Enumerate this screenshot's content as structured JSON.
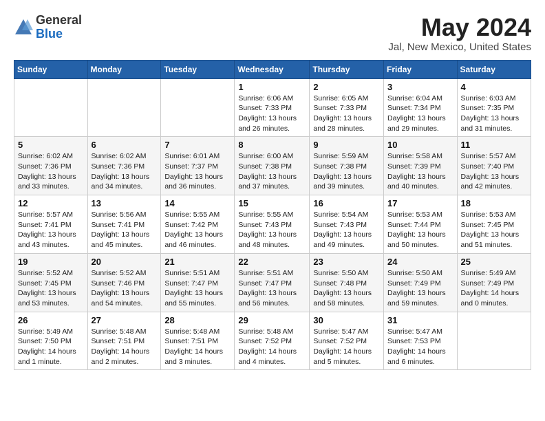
{
  "header": {
    "logo_general": "General",
    "logo_blue": "Blue",
    "title": "May 2024",
    "location": "Jal, New Mexico, United States"
  },
  "weekdays": [
    "Sunday",
    "Monday",
    "Tuesday",
    "Wednesday",
    "Thursday",
    "Friday",
    "Saturday"
  ],
  "weeks": [
    [
      {
        "day": "",
        "info": ""
      },
      {
        "day": "",
        "info": ""
      },
      {
        "day": "",
        "info": ""
      },
      {
        "day": "1",
        "info": "Sunrise: 6:06 AM\nSunset: 7:33 PM\nDaylight: 13 hours\nand 26 minutes."
      },
      {
        "day": "2",
        "info": "Sunrise: 6:05 AM\nSunset: 7:33 PM\nDaylight: 13 hours\nand 28 minutes."
      },
      {
        "day": "3",
        "info": "Sunrise: 6:04 AM\nSunset: 7:34 PM\nDaylight: 13 hours\nand 29 minutes."
      },
      {
        "day": "4",
        "info": "Sunrise: 6:03 AM\nSunset: 7:35 PM\nDaylight: 13 hours\nand 31 minutes."
      }
    ],
    [
      {
        "day": "5",
        "info": "Sunrise: 6:02 AM\nSunset: 7:36 PM\nDaylight: 13 hours\nand 33 minutes."
      },
      {
        "day": "6",
        "info": "Sunrise: 6:02 AM\nSunset: 7:36 PM\nDaylight: 13 hours\nand 34 minutes."
      },
      {
        "day": "7",
        "info": "Sunrise: 6:01 AM\nSunset: 7:37 PM\nDaylight: 13 hours\nand 36 minutes."
      },
      {
        "day": "8",
        "info": "Sunrise: 6:00 AM\nSunset: 7:38 PM\nDaylight: 13 hours\nand 37 minutes."
      },
      {
        "day": "9",
        "info": "Sunrise: 5:59 AM\nSunset: 7:38 PM\nDaylight: 13 hours\nand 39 minutes."
      },
      {
        "day": "10",
        "info": "Sunrise: 5:58 AM\nSunset: 7:39 PM\nDaylight: 13 hours\nand 40 minutes."
      },
      {
        "day": "11",
        "info": "Sunrise: 5:57 AM\nSunset: 7:40 PM\nDaylight: 13 hours\nand 42 minutes."
      }
    ],
    [
      {
        "day": "12",
        "info": "Sunrise: 5:57 AM\nSunset: 7:41 PM\nDaylight: 13 hours\nand 43 minutes."
      },
      {
        "day": "13",
        "info": "Sunrise: 5:56 AM\nSunset: 7:41 PM\nDaylight: 13 hours\nand 45 minutes."
      },
      {
        "day": "14",
        "info": "Sunrise: 5:55 AM\nSunset: 7:42 PM\nDaylight: 13 hours\nand 46 minutes."
      },
      {
        "day": "15",
        "info": "Sunrise: 5:55 AM\nSunset: 7:43 PM\nDaylight: 13 hours\nand 48 minutes."
      },
      {
        "day": "16",
        "info": "Sunrise: 5:54 AM\nSunset: 7:43 PM\nDaylight: 13 hours\nand 49 minutes."
      },
      {
        "day": "17",
        "info": "Sunrise: 5:53 AM\nSunset: 7:44 PM\nDaylight: 13 hours\nand 50 minutes."
      },
      {
        "day": "18",
        "info": "Sunrise: 5:53 AM\nSunset: 7:45 PM\nDaylight: 13 hours\nand 51 minutes."
      }
    ],
    [
      {
        "day": "19",
        "info": "Sunrise: 5:52 AM\nSunset: 7:45 PM\nDaylight: 13 hours\nand 53 minutes."
      },
      {
        "day": "20",
        "info": "Sunrise: 5:52 AM\nSunset: 7:46 PM\nDaylight: 13 hours\nand 54 minutes."
      },
      {
        "day": "21",
        "info": "Sunrise: 5:51 AM\nSunset: 7:47 PM\nDaylight: 13 hours\nand 55 minutes."
      },
      {
        "day": "22",
        "info": "Sunrise: 5:51 AM\nSunset: 7:47 PM\nDaylight: 13 hours\nand 56 minutes."
      },
      {
        "day": "23",
        "info": "Sunrise: 5:50 AM\nSunset: 7:48 PM\nDaylight: 13 hours\nand 58 minutes."
      },
      {
        "day": "24",
        "info": "Sunrise: 5:50 AM\nSunset: 7:49 PM\nDaylight: 13 hours\nand 59 minutes."
      },
      {
        "day": "25",
        "info": "Sunrise: 5:49 AM\nSunset: 7:49 PM\nDaylight: 14 hours\nand 0 minutes."
      }
    ],
    [
      {
        "day": "26",
        "info": "Sunrise: 5:49 AM\nSunset: 7:50 PM\nDaylight: 14 hours\nand 1 minute."
      },
      {
        "day": "27",
        "info": "Sunrise: 5:48 AM\nSunset: 7:51 PM\nDaylight: 14 hours\nand 2 minutes."
      },
      {
        "day": "28",
        "info": "Sunrise: 5:48 AM\nSunset: 7:51 PM\nDaylight: 14 hours\nand 3 minutes."
      },
      {
        "day": "29",
        "info": "Sunrise: 5:48 AM\nSunset: 7:52 PM\nDaylight: 14 hours\nand 4 minutes."
      },
      {
        "day": "30",
        "info": "Sunrise: 5:47 AM\nSunset: 7:52 PM\nDaylight: 14 hours\nand 5 minutes."
      },
      {
        "day": "31",
        "info": "Sunrise: 5:47 AM\nSunset: 7:53 PM\nDaylight: 14 hours\nand 6 minutes."
      },
      {
        "day": "",
        "info": ""
      }
    ]
  ]
}
